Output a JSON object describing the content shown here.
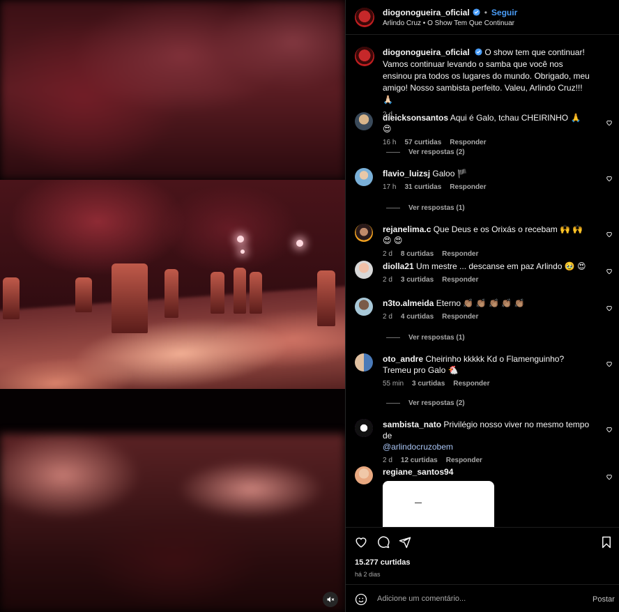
{
  "header": {
    "username": "diogonogueira_oficial",
    "dot": "•",
    "follow": "Seguir",
    "audio": "Arlindo Cruz • O Show Tem Que Continuar"
  },
  "caption": {
    "username": "diogonogueira_oficial",
    "text": "O show tem que continuar! Vamos continuar levando o samba que você nos ensinou pra todos os lugares do mundo. Obrigado, meu amigo! Nosso sambista perfeito. Valeu, Arlindo Cruz!!! 🙏🏻",
    "time": "2 d"
  },
  "comments": [
    {
      "user": "dieicksonsantos",
      "text": "Aqui é Galo, tchau CHEIRINHO 🙏 😍",
      "time": "16 h",
      "likes": "57 curtidas",
      "reply": "Responder",
      "replies": "Ver respostas (2)"
    },
    {
      "user": "flavio_luizsj",
      "text": "Galoo 🏴",
      "time": "17 h",
      "likes": "31 curtidas",
      "reply": "Responder",
      "replies": "Ver respostas (1)"
    },
    {
      "user": "rejanelima.c",
      "text": "Que Deus e os Orixás o recebam 🙌 🙌 😍 😍",
      "time": "2 d",
      "likes": "8 curtidas",
      "reply": "Responder"
    },
    {
      "user": "diolla21",
      "text": "Um mestre ... descanse em paz Arlindo 🥹 😍",
      "time": "2 d",
      "likes": "3 curtidas",
      "reply": "Responder"
    },
    {
      "user": "n3to.almeida",
      "text": "Eterno 👏🏽 👏🏽 👏🏽 👏🏽 👏🏽",
      "time": "2 d",
      "likes": "4 curtidas",
      "reply": "Responder",
      "replies": "Ver respostas (1)"
    },
    {
      "user": "oto_andre",
      "text": "Cheirinho kkkkk Kd o Flamenguinho? Tremeu pro Galo 🐔",
      "time": "55 min",
      "likes": "3 curtidas",
      "reply": "Responder",
      "replies": "Ver respostas (2)"
    },
    {
      "user": "sambista_nato",
      "text": "Privilégio nosso viver no mesmo tempo de",
      "mention": "@arlindocruzobem",
      "time": "2 d",
      "likes": "12 curtidas",
      "reply": "Responder"
    },
    {
      "user": "regiane_santos94"
    }
  ],
  "footer": {
    "likes": "15.277 curtidas",
    "time": "há 2 dias",
    "placeholder": "Adicione um comentário...",
    "post": "Postar"
  },
  "colors": {
    "accent": "#4a9df8",
    "background": "#000000",
    "muted": "#a8a8a8"
  },
  "icons": [
    "heart-icon",
    "comment-icon",
    "share-icon",
    "bookmark-icon",
    "emoji-icon",
    "mute-icon",
    "verified-icon"
  ]
}
